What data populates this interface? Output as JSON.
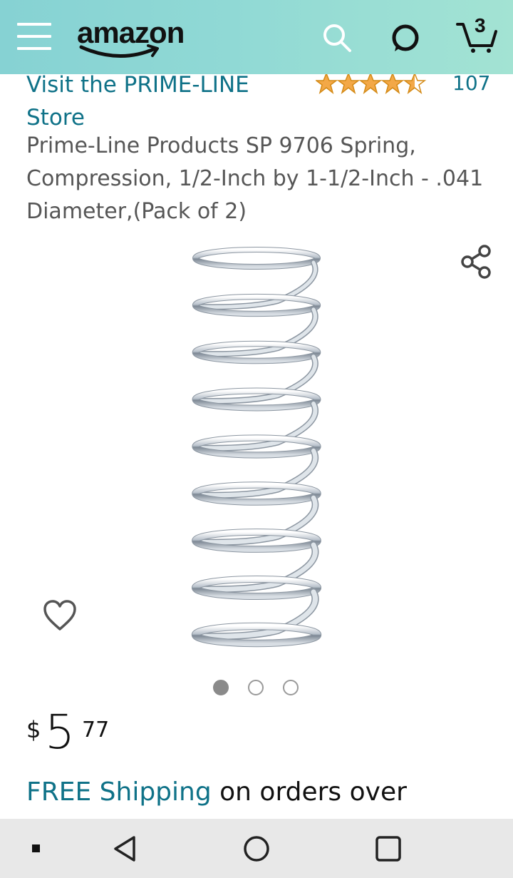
{
  "header": {
    "logo_text": "amazon",
    "cart_count": "3",
    "colors": {
      "bar_start": "#86d2d3",
      "bar_end": "#a3e3d3"
    },
    "icons": [
      "menu-icon",
      "search-icon",
      "alexa-icon",
      "cart-icon"
    ]
  },
  "product": {
    "store_link": "Visit the PRIME-LINE Store",
    "rating": 4.5,
    "review_count": "107",
    "title": "Prime-Line Products SP 9706 Spring, Compression, 1/2-Inch by 1-1/2-Inch - .041 Diameter,(Pack of 2)",
    "image_dots": {
      "count": 3,
      "active_index": 0
    },
    "price": {
      "symbol": "$",
      "whole": "5",
      "fraction": "77"
    },
    "shipping": {
      "free_label": "FREE Shipping",
      "rest": " on orders over"
    },
    "colors": {
      "link": "#0f7288",
      "star": "#f3a847"
    }
  },
  "navbar": {
    "icons": [
      "recent-apps-dot-icon",
      "back-icon",
      "home-icon",
      "overview-icon"
    ]
  }
}
